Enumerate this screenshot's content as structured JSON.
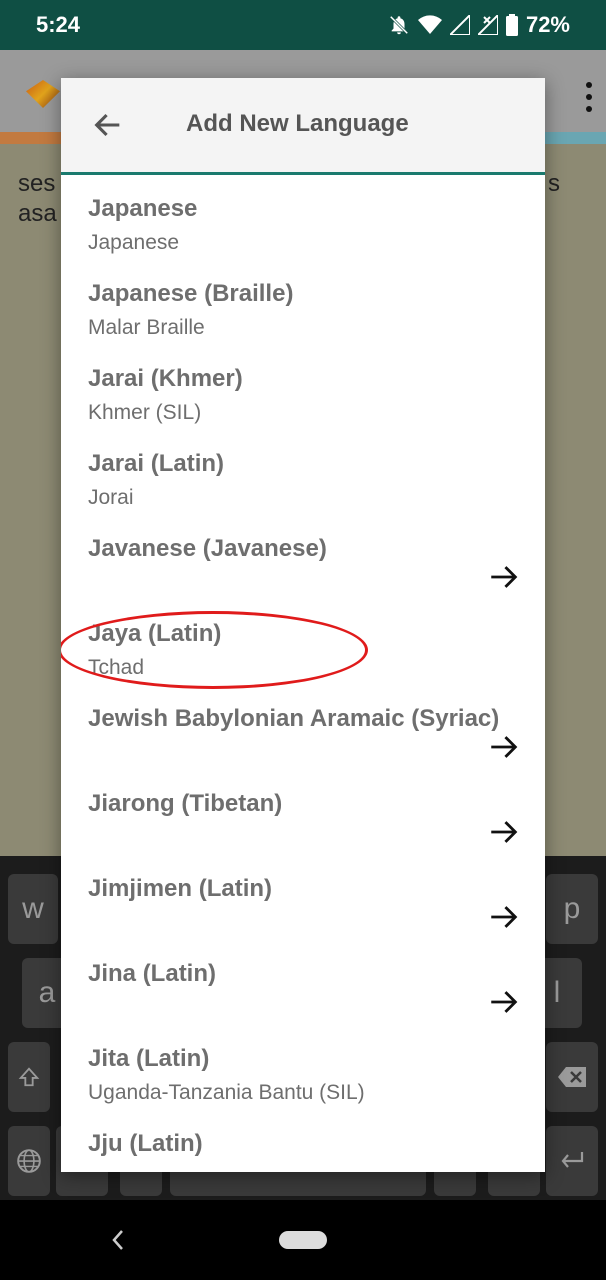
{
  "status_bar": {
    "time": "5:24",
    "battery": "72%"
  },
  "background": {
    "text_line1": "ses",
    "text_line2": "asa",
    "text_right": "s"
  },
  "keyboard": {
    "keys": [
      "w",
      "p",
      "a",
      "l"
    ]
  },
  "dialog": {
    "title": "Add New Language",
    "items": [
      {
        "name": "Japanese",
        "sub": "Japanese",
        "arrow": false
      },
      {
        "name": "Japanese (Braille)",
        "sub": "Malar Braille",
        "arrow": false
      },
      {
        "name": "Jarai (Khmer)",
        "sub": "Khmer (SIL)",
        "arrow": false
      },
      {
        "name": "Jarai (Latin)",
        "sub": "Jorai",
        "arrow": false
      },
      {
        "name": "Javanese (Javanese)",
        "sub": "",
        "arrow": true
      },
      {
        "name": "Jaya (Latin)",
        "sub": "Tchad",
        "arrow": false
      },
      {
        "name": "Jewish Babylonian Aramaic (Syriac)",
        "sub": "",
        "arrow": true
      },
      {
        "name": "Jiarong (Tibetan)",
        "sub": "",
        "arrow": true
      },
      {
        "name": "Jimjimen (Latin)",
        "sub": "",
        "arrow": true
      },
      {
        "name": "Jina (Latin)",
        "sub": "",
        "arrow": true
      },
      {
        "name": "Jita (Latin)",
        "sub": "Uganda-Tanzania Bantu (SIL)",
        "arrow": false
      },
      {
        "name": "Jju (Latin)",
        "sub": "",
        "arrow": false
      }
    ],
    "highlighted_item": "Javanese (Javanese)",
    "highlight_color": "#e01b1b",
    "header_accent": "#1a7a6e"
  }
}
